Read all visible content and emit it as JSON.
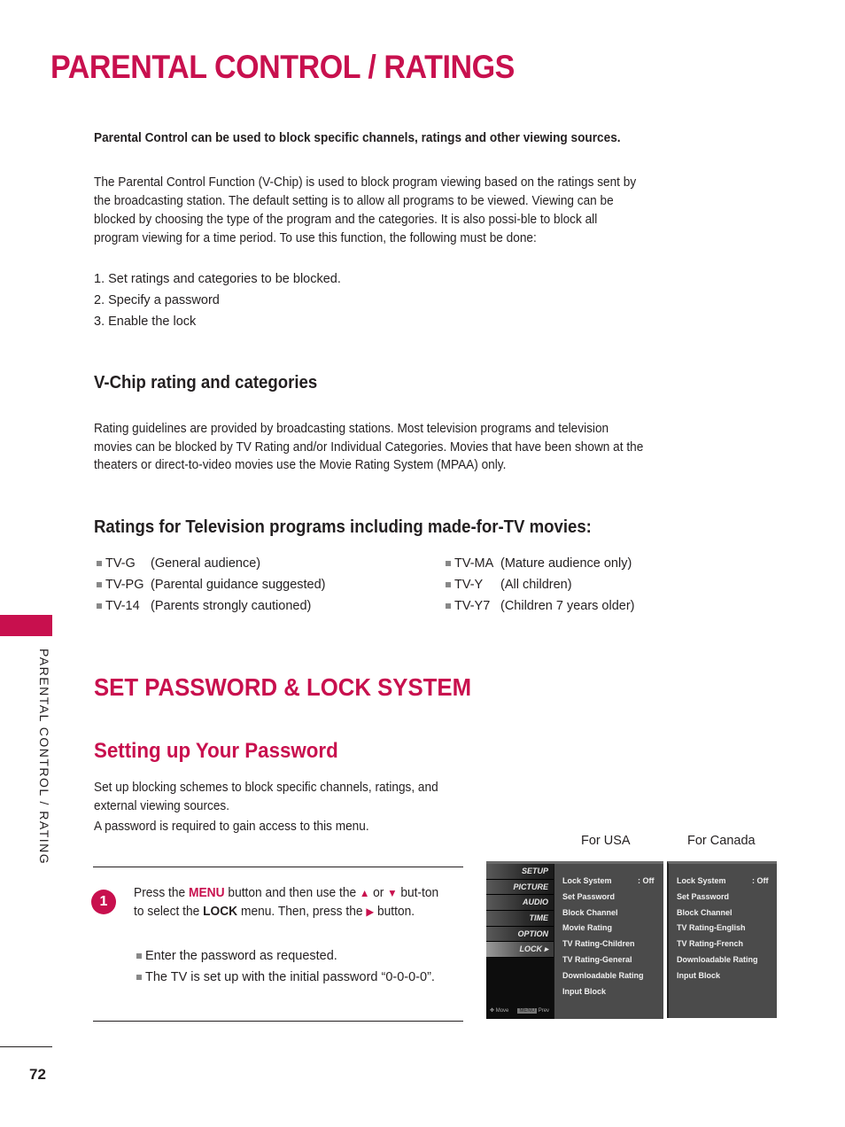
{
  "page": {
    "title": "PARENTAL CONTROL / RATINGS",
    "side_label": "PARENTAL CONTROL / RATING",
    "page_number": "72",
    "accent_color": "#c8104e"
  },
  "intro": {
    "lead": "Parental Control can be used to block specific channels, ratings and other viewing sources.",
    "paragraph": "The Parental Control Function (V-Chip) is used to block program viewing based on the ratings sent by the broadcasting station. The default setting is to allow all programs to be viewed. Viewing can be blocked by choosing the type of the program and the categories. It is also possi-ble to block all program viewing for a time period. To use this function, the following must be done:",
    "steps": [
      "1. Set ratings and categories to be blocked.",
      "2. Specify a password",
      "3. Enable the lock"
    ]
  },
  "vchip": {
    "heading": "V-Chip rating and categories",
    "paragraph": "Rating guidelines are provided by broadcasting stations. Most television programs and television movies can be blocked by TV Rating and/or Individual Categories. Movies that have been shown at the theaters or direct-to-video movies use the Movie Rating System (MPAA) only."
  },
  "tv_ratings": {
    "heading": "Ratings for Television programs including made-for-TV movies:",
    "left": [
      {
        "code": "TV-G",
        "desc": "(General audience)"
      },
      {
        "code": "TV-PG",
        "desc": "(Parental guidance suggested)"
      },
      {
        "code": "TV-14",
        "desc": "(Parents strongly cautioned)"
      }
    ],
    "right": [
      {
        "code": "TV-MA",
        "desc": "(Mature audience only)"
      },
      {
        "code": "TV-Y",
        "desc": "(All children)"
      },
      {
        "code": "TV-Y7",
        "desc": "(Children 7 years older)"
      }
    ]
  },
  "lock_section": {
    "title": "SET PASSWORD & LOCK SYSTEM",
    "subtitle": "Setting up Your Password",
    "paragraph": "Set up blocking schemes to block specific channels, ratings, and external viewing sources.",
    "paragraph2": "A password is required to gain access to this menu.",
    "step": {
      "number": "1",
      "t1": "Press the ",
      "menu_key": "MENU",
      "t2": " button and then use the ",
      "up_icon": "▲",
      "t3": " or ",
      "down_icon": "▼",
      "t4": " but-ton to select the ",
      "lock_key": "LOCK",
      "t5": " menu. Then, press the ",
      "right_icon": "▶",
      "t6": " button."
    },
    "bullets": [
      "Enter the password as requested.",
      "The TV is set up with the initial password “0-0-0-0”."
    ]
  },
  "screens": {
    "usa_label": "For USA",
    "canada_label": "For Canada",
    "sidebar": [
      "SETUP",
      "PICTURE",
      "AUDIO",
      "TIME",
      "OPTION",
      "LOCK ▸"
    ],
    "footer_move": "Move",
    "footer_menu": "MENU",
    "footer_prev": "Prev",
    "usa_menu": [
      {
        "label": "Lock System",
        "value": ": Off"
      },
      {
        "label": "Set Password",
        "value": ""
      },
      {
        "label": "Block Channel",
        "value": ""
      },
      {
        "label": "Movie Rating",
        "value": ""
      },
      {
        "label": "TV Rating-Children",
        "value": ""
      },
      {
        "label": "TV Rating-General",
        "value": ""
      },
      {
        "label": "Downloadable Rating",
        "value": ""
      },
      {
        "label": "Input Block",
        "value": ""
      }
    ],
    "canada_menu": [
      {
        "label": "Lock System",
        "value": ": Off"
      },
      {
        "label": "Set Password",
        "value": ""
      },
      {
        "label": "Block Channel",
        "value": ""
      },
      {
        "label": "TV Rating-English",
        "value": ""
      },
      {
        "label": "TV Rating-French",
        "value": ""
      },
      {
        "label": "Downloadable Rating",
        "value": ""
      },
      {
        "label": "Input Block",
        "value": ""
      }
    ]
  }
}
